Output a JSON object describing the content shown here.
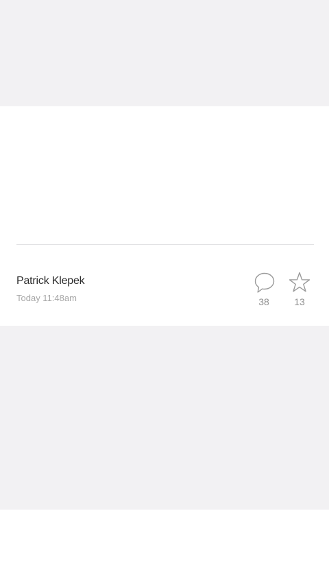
{
  "post": {
    "author": "Patrick Klepek",
    "timestamp": "Today 11:48am",
    "comments": {
      "icon": "comment-bubble-icon",
      "count": "38"
    },
    "stars": {
      "icon": "star-icon",
      "count": "13"
    }
  },
  "colors": {
    "background": "#f2f1f3",
    "card": "#ffffff",
    "divider": "#e2e2e4",
    "author_text": "#2b2b2b",
    "muted_text": "#a6a6a6",
    "icon_stroke": "#9a9a9a"
  }
}
